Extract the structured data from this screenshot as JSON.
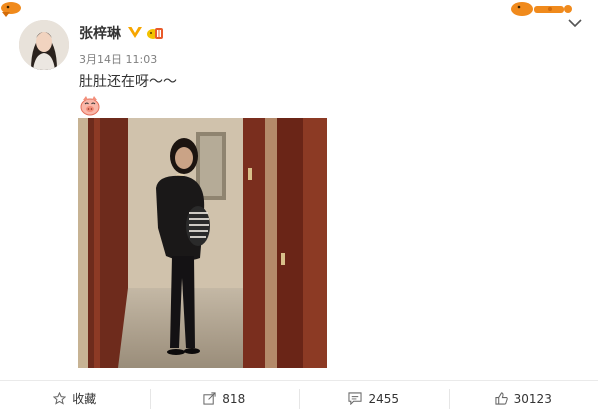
{
  "post": {
    "username": "张梓琳",
    "date": "3月14日",
    "time": "11:03",
    "text": "肚肚还在呀～～"
  },
  "actions": [
    {
      "label": "收藏",
      "icon": "star-icon"
    },
    {
      "label": "818",
      "icon": "share-icon"
    },
    {
      "label": "2455",
      "icon": "comment-icon"
    },
    {
      "label": "30123",
      "icon": "thumbs-up-icon"
    }
  ],
  "colors": {
    "accent": "#f7a600",
    "vip_red": "#e95a2a",
    "meta_gray": "#808080"
  }
}
